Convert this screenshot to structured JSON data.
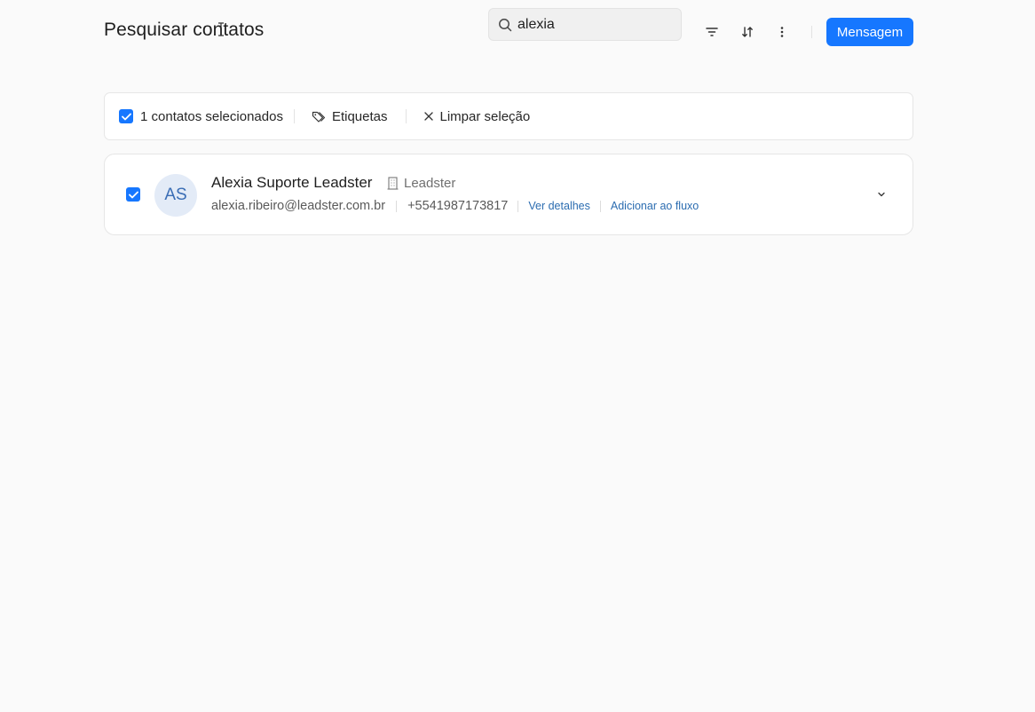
{
  "header": {
    "title": "Pesquisar contatos",
    "search": {
      "value": "alexia",
      "icon": "search-icon"
    },
    "filter_icon": "filter-icon",
    "sort_icon": "sort-icon",
    "more_icon": "more-vertical-icon",
    "message_button": "Mensagem"
  },
  "selection_bar": {
    "count_label": "1 contatos selecionados",
    "tags_label": "Etiquetas",
    "clear_label": "Limpar seleção"
  },
  "contacts": [
    {
      "initials": "AS",
      "name": "Alexia Suporte Leadster",
      "company": "Leadster",
      "email": "alexia.ribeiro@leadster.com.br",
      "phone": "+5541987173817",
      "details_link": "Ver detalhes",
      "flow_link": "Adicionar ao fluxo",
      "selected": true
    }
  ],
  "colors": {
    "accent": "#1677ff",
    "link": "#2b6cb0",
    "avatar_bg": "#e3ebf7",
    "avatar_text": "#3a6db5"
  }
}
